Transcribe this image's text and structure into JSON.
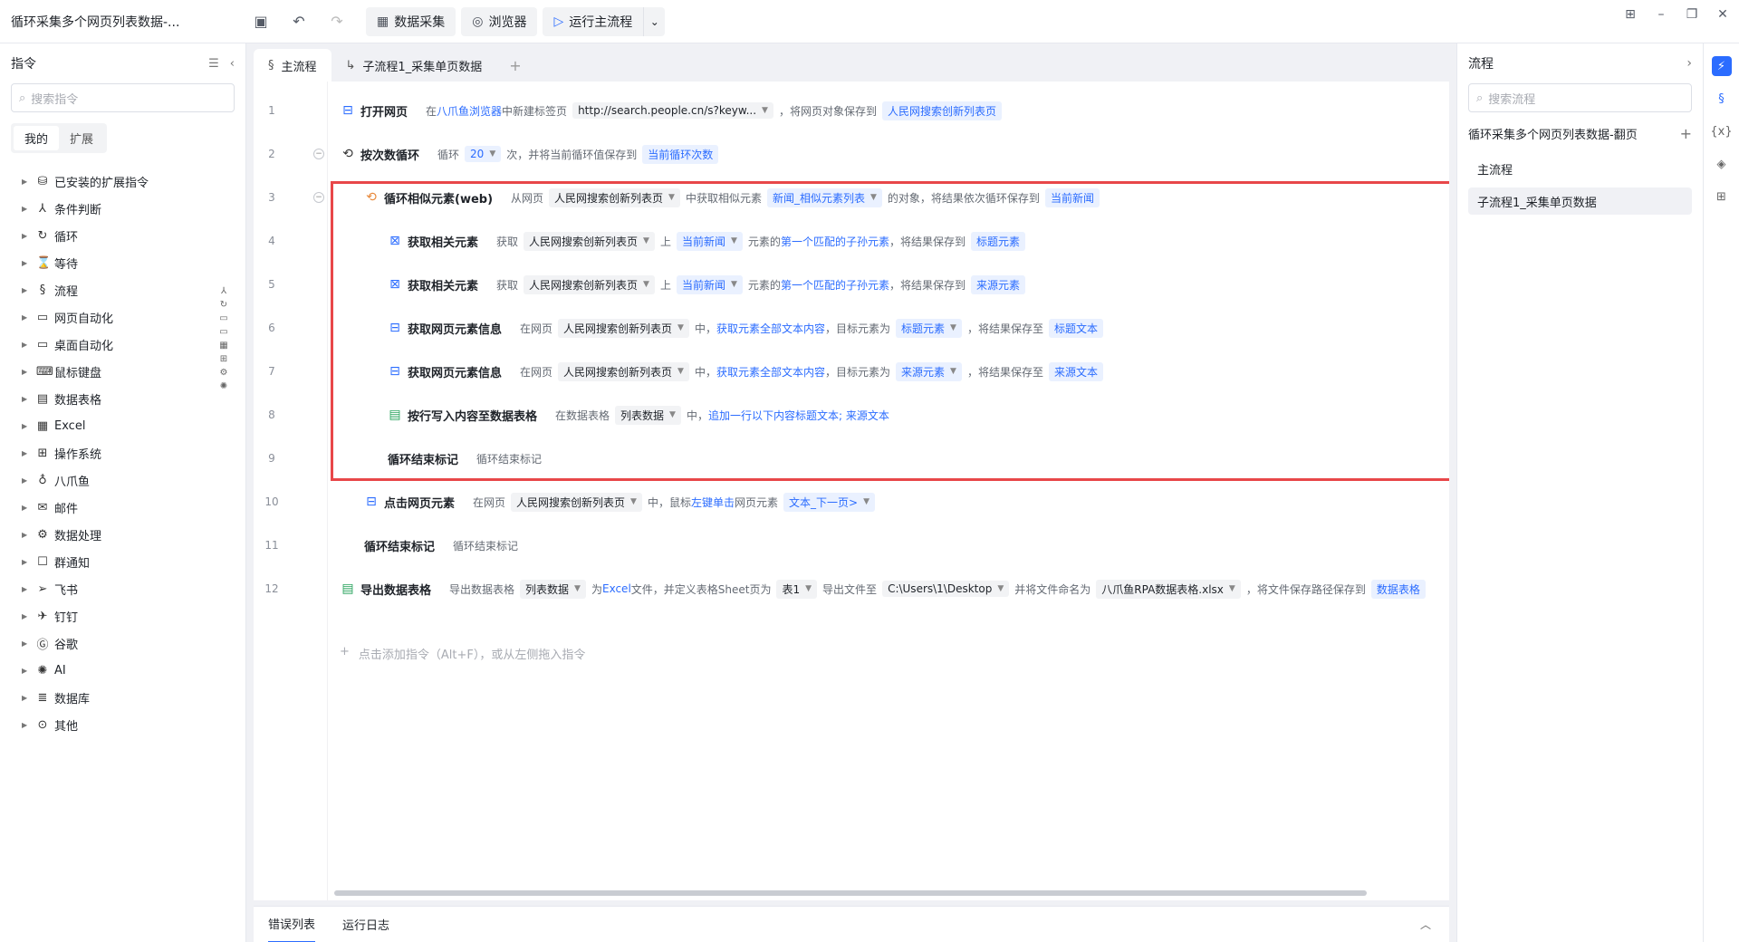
{
  "app": {
    "title": "循环采集多个网页列表数据-..."
  },
  "toolbar": {
    "data_collect": "数据采集",
    "browser": "浏览器",
    "run_main": "运行主流程"
  },
  "left": {
    "title": "指令",
    "search_placeholder": "搜索指令",
    "seg": [
      "我的",
      "扩展"
    ],
    "categories": [
      "已安装的扩展指令",
      "条件判断",
      "循环",
      "等待",
      "流程",
      "网页自动化",
      "桌面自动化",
      "鼠标键盘",
      "数据表格",
      "Excel",
      "操作系统",
      "八爪鱼",
      "邮件",
      "数据处理",
      "群通知",
      "飞书",
      "钉钉",
      "谷歌",
      "AI",
      "数据库",
      "其他"
    ]
  },
  "tabs": {
    "main": "主流程",
    "sub": "子流程1_采集单页数据"
  },
  "rows": {
    "r1": {
      "n": "1",
      "name": "打开网页",
      "t1": "在",
      "l1": "八爪鱼浏览器",
      "t2": "中新建标签页",
      "s1": "http://search.people.cn/s?keyw...",
      "t3": "，将网页对象保存到",
      "v1": "人民网搜索创新列表页"
    },
    "r2": {
      "n": "2",
      "name": "按次数循环",
      "t1": "循环",
      "s1": "20",
      "t2": "次，并将当前循环值保存到",
      "v1": "当前循环次数"
    },
    "r3": {
      "n": "3",
      "name": "循环相似元素(web)",
      "t1": "从网页",
      "s1": "人民网搜索创新列表页",
      "t2": "中获取相似元素",
      "s2": "新闻_相似元素列表",
      "t3": "的对象，将结果依次循环保存到",
      "v1": "当前新闻"
    },
    "r4": {
      "n": "4",
      "name": "获取相关元素",
      "t1": "获取",
      "s1": "人民网搜索创新列表页",
      "t2": "上",
      "s2": "当前新闻",
      "t3": "元素的",
      "l1": "第一个匹配的子孙元素",
      "t4": "，将结果保存到",
      "v1": "标题元素"
    },
    "r5": {
      "n": "5",
      "name": "获取相关元素",
      "t1": "获取",
      "s1": "人民网搜索创新列表页",
      "t2": "上",
      "s2": "当前新闻",
      "t3": "元素的",
      "l1": "第一个匹配的子孙元素",
      "t4": "，将结果保存到",
      "v1": "来源元素"
    },
    "r6": {
      "n": "6",
      "name": "获取网页元素信息",
      "t1": "在网页",
      "s1": "人民网搜索创新列表页",
      "t2": "中，",
      "l1": "获取元素全部文本内容",
      "t3": "，目标元素为",
      "s2": "标题元素",
      "t4": "，将结果保存至",
      "v1": "标题文本"
    },
    "r7": {
      "n": "7",
      "name": "获取网页元素信息",
      "t1": "在网页",
      "s1": "人民网搜索创新列表页",
      "t2": "中，",
      "l1": "获取元素全部文本内容",
      "t3": "，目标元素为",
      "s2": "来源元素",
      "t4": "，将结果保存至",
      "v1": "来源文本"
    },
    "r8": {
      "n": "8",
      "name": "按行写入内容至数据表格",
      "t1": "在数据表格",
      "s1": "列表数据",
      "t2": "中，",
      "l1": "追加一行以下内容",
      "l2": "标题文本; 来源文本"
    },
    "r9": {
      "n": "9",
      "name": "循环结束标记",
      "t1": "循环结束标记"
    },
    "r10": {
      "n": "10",
      "name": "点击网页元素",
      "t1": "在网页",
      "s1": "人民网搜索创新列表页",
      "t2": "中，鼠标",
      "l1": "左键单击",
      "t3": "网页元素",
      "s2": "文本_下一页>"
    },
    "r11": {
      "n": "11",
      "name": "循环结束标记",
      "t1": "循环结束标记"
    },
    "r12": {
      "n": "12",
      "name": "导出数据表格",
      "t1": "导出数据表格",
      "s1": "列表数据",
      "t2": "为",
      "l1": "Excel",
      "t3": "文件，并定义表格Sheet页为",
      "s2": "表1",
      "t4": "导出文件至",
      "s3": "C:\\Users\\1\\Desktop",
      "t5": "并将文件命名为",
      "s4": "八爪鱼RPA数据表格.xlsx",
      "t6": "，将文件保存路径保存到",
      "v1": "数据表格"
    }
  },
  "add_hint": {
    "a": "点击添加指令（Alt+F）",
    "b": "，或从左侧拖入指令"
  },
  "bottom": {
    "errors": "错误列表",
    "logs": "运行日志"
  },
  "right": {
    "title": "流程",
    "search_placeholder": "搜索流程",
    "project": "循环采集多个网页列表数据-翻页",
    "items": [
      "主流程",
      "子流程1_采集单页数据"
    ]
  }
}
